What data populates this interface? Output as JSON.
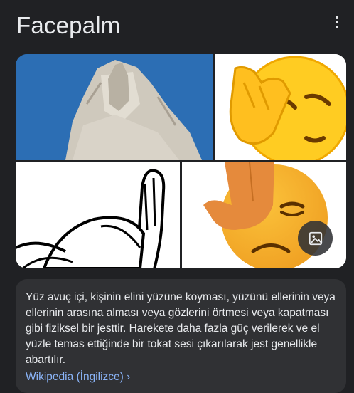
{
  "header": {
    "title": "Facepalm",
    "more_icon": "more-vert-icon"
  },
  "gallery": {
    "images": [
      {
        "subject": "statue-facepalm"
      },
      {
        "subject": "emoji-facepalm-yellow"
      },
      {
        "subject": "cartoon-facepalm-drawing"
      },
      {
        "subject": "emoji-facepalm-orange"
      }
    ],
    "badge_icon": "image-icon"
  },
  "description": {
    "text": "Yüz avuç içi, kişinin elini yüzüne koyması, yüzünü ellerinin veya ellerinin arasına alması veya gözlerini örtmesi veya kapatması gibi fiziksel bir jesttir. Harekete daha fazla güç verilerek ve el yüzle temas ettiğinde bir tokat sesi çıkarılarak jest genellikle abartılır.",
    "source_link": "Wikipedia (İngilizce)",
    "chevron": "›"
  },
  "colors": {
    "background": "#202124",
    "card": "#303134",
    "text": "#e8eaed",
    "link": "#8ab4f8"
  }
}
